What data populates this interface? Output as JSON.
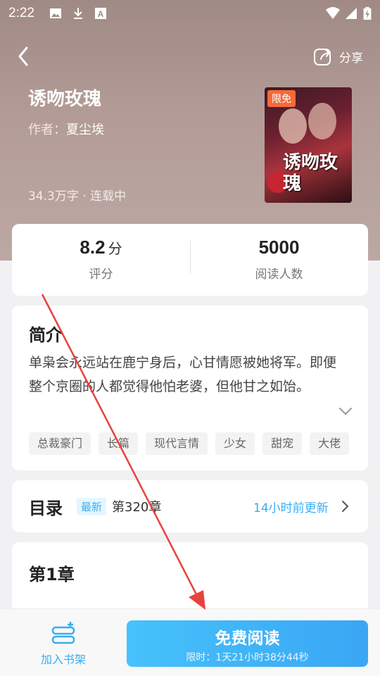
{
  "status_bar": {
    "time": "2:22",
    "icons": [
      "image-icon",
      "download-icon",
      "a-icon",
      "wifi-icon",
      "signal-icon",
      "battery-icon"
    ]
  },
  "nav": {
    "back_icon": "chevron-left-icon",
    "share_label": "分享",
    "share_icon": "share-icon"
  },
  "book": {
    "title": "诱吻玫瑰",
    "author_label": "作者：",
    "author": "夏尘埃",
    "meta": "34.3万字 · 连载中",
    "cover_badge": "限免",
    "cover_title": "诱吻玫瑰"
  },
  "stats": {
    "rating_value": "8.2",
    "rating_unit": "分",
    "rating_label": "评分",
    "readers_value": "5000",
    "readers_label": "阅读人数"
  },
  "intro": {
    "title": "简介",
    "text": "单枭会永远站在鹿宁身后，心甘情愿被她将军。即便整个京圈的人都觉得他怕老婆，但他甘之如饴。",
    "tags": [
      "总裁豪门",
      "长篇",
      "现代言情",
      "少女",
      "甜宠",
      "大佬"
    ]
  },
  "toc": {
    "title": "目录",
    "badge": "最新",
    "chapter": "第320章",
    "update": "14小时前更新"
  },
  "chapter": {
    "title": "第1章"
  },
  "bottom": {
    "shelf_label": "加入书架",
    "read_label": "免费阅读",
    "read_sub": "限时：1天21小时38分44秒"
  },
  "colors": {
    "accent": "#3aaef0",
    "badge": "#f46a3a",
    "annotation_arrow": "#e8423d"
  }
}
